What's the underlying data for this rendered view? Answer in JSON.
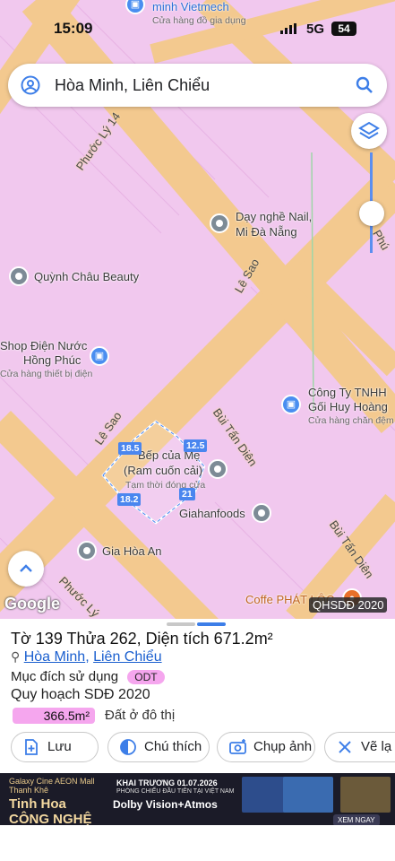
{
  "status_bar": {
    "time": "15:09",
    "network": "5G",
    "battery": "54"
  },
  "search": {
    "text": "Hòa Minh, Liên Chiểu"
  },
  "map": {
    "top_poi": {
      "name": "minh Vietmech",
      "sub": "Cửa hàng đồ gia dụng"
    },
    "streets": [
      "Phước Lý 14",
      "Lê Sao",
      "Lê Sao",
      "Bùi Tấn Diên",
      "Bùi Tấn Diên",
      "Phước Lý",
      "Phú"
    ],
    "pois": [
      {
        "name": "Dạy nghề Nail,",
        "name2": "Mi Đà Nẵng"
      },
      {
        "name": "Quỳnh Châu Beauty"
      },
      {
        "name": "Shop Điện Nước",
        "name2": "Hồng Phúc",
        "sub": "Cửa hàng thiết bị điện"
      },
      {
        "name": "Công Ty TNHH",
        "name2": "Gối Huy Hoàng",
        "sub": "Cửa hàng chăn đệm"
      },
      {
        "name": "Bếp của Mẹ",
        "name2": "(Ram cuốn cải)",
        "sub": "Tạm thời đóng cửa"
      },
      {
        "name": "Giahanfoods"
      },
      {
        "name": "Gia Hòa An"
      },
      {
        "name": "Coffe PHÁT LỘC"
      }
    ],
    "parcel_edges": [
      "18.5",
      "12.5",
      "18.2",
      "21"
    ],
    "attribution": "Google",
    "layer_tag": "QHSDĐ 2020"
  },
  "parcel": {
    "title": "Tờ 139 Thửa 262, Diện tích 671.2m²",
    "ward": "Hòa Minh",
    "district": "Liên Chiểu",
    "purpose_label": "Mục đích sử dụng",
    "purpose_code": "ODT",
    "plan_label": "Quy hoạch SDĐ 2020",
    "plan_area": "366.5m²",
    "plan_area_fill": 1.0,
    "plan_desc": "Đất ở đô thị"
  },
  "actions": [
    {
      "label": "Lưu",
      "icon": "save-icon"
    },
    {
      "label": "Chú thích",
      "icon": "legend-icon"
    },
    {
      "label": "Chụp ảnh",
      "icon": "camera-icon"
    },
    {
      "label": "Vẽ lạ",
      "icon": "draw-icon"
    }
  ],
  "ad": {
    "brand_line1": "Galaxy Cine AEON Mall Thanh Khê",
    "brand_line2": "Tinh Hoa CÔNG NGHỆ ĐIỆN ẢNH",
    "headline": "KHAI TRƯƠNG 01.07.2026",
    "subline": "PHÒNG CHIẾU ĐẦU TIÊN TẠI VIỆT NAM",
    "tech": "Dolby Vision+Atmos",
    "cta": "XEM NGAY"
  },
  "colors": {
    "land": "#f1c8ee",
    "road": "#f3c98f",
    "accent": "#4a86ef",
    "badge": "#f5a6ee"
  }
}
